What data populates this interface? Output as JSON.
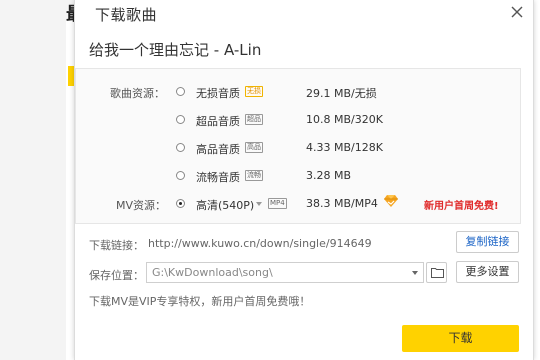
{
  "background": {
    "left_title_fragment": "最"
  },
  "dialog": {
    "title": "下载歌曲",
    "song_title": "给我一个理由忘记 - A-Lin",
    "song_source_label": "歌曲资源：",
    "mv_source_label": "MV资源：",
    "audio_qualities": [
      {
        "label": "无损音质",
        "tag": "无损",
        "tag_style": "gold",
        "size": "29.1 MB/无损",
        "selected": false
      },
      {
        "label": "超品音质",
        "tag": "超品",
        "tag_style": "plain",
        "size": "10.8 MB/320K",
        "selected": false
      },
      {
        "label": "高品音质",
        "tag": "高品",
        "tag_style": "plain",
        "size": "4.33 MB/128K",
        "selected": false
      },
      {
        "label": "流畅音质",
        "tag": "流畅",
        "tag_style": "plain",
        "size": "3.28 MB",
        "selected": false
      }
    ],
    "mv_quality": {
      "label": "高清(540P)",
      "format_tag": "MP4",
      "size": "38.3 MB/MP4",
      "selected": true
    },
    "promo_text": "新用户首周免费!",
    "download_link_label": "下载链接：",
    "download_link_url": "http://www.kuwo.cn/down/single/914649",
    "copy_link_button": "复制链接",
    "save_path_label": "保存位置：",
    "save_path_value": "G:\\KwDownload\\song\\",
    "more_settings_button": "更多设置",
    "vip_note": "下载MV是VIP专享特权，新用户首周免费哦！",
    "download_button": "下载"
  },
  "colors": {
    "accent_yellow": "#ffd200",
    "promo_red": "#e02b2b",
    "link_blue": "#1a63c6",
    "diamond_orange": "#f5a623"
  }
}
